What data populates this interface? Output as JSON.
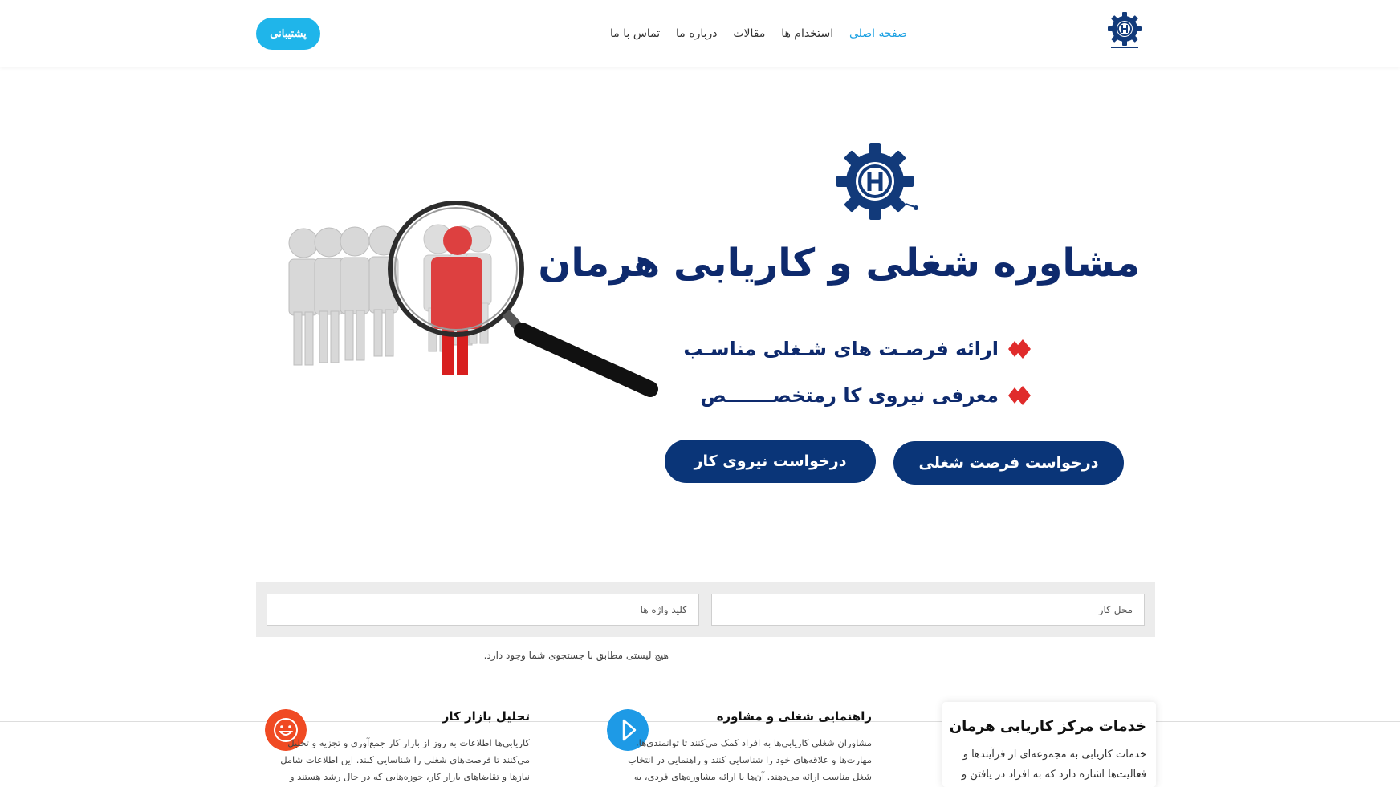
{
  "header": {
    "logo_icon": "hermanc-gear-logo-icon",
    "nav": [
      {
        "label": "صفحه اصلی",
        "active": true
      },
      {
        "label": "استخدام ها",
        "active": false
      },
      {
        "label": "مقالات",
        "active": false
      },
      {
        "label": "درباره ما",
        "active": false
      },
      {
        "label": "تماس با ما",
        "active": false
      }
    ],
    "support_label": "پشتیبانی"
  },
  "hero": {
    "title": "مشاوره شغلی و کاریابی هرمان",
    "bullets": [
      "ارائه فرصـت های شـغلی مناسـب",
      "معرفی نیروی کا رمتخصـــــــص"
    ],
    "cta_job": "درخواست فرصت شغلی",
    "cta_labor": "درخواست نیروی کار",
    "illustration": "magnifier-over-people-illustration"
  },
  "search": {
    "location_placeholder": "محل کار",
    "keywords_placeholder": "کلید واژه ها",
    "no_results": "هیچ لیستی مطابق با جستجوی شما وجود دارد."
  },
  "services": {
    "title": "خدمات مرکز کاریابی هرمان",
    "text": "خدمات کاریابی به مجموعه‌ای از فرآیندها و فعالیت‌ها اشاره دارد که به افراد در یافتن و"
  },
  "features": [
    {
      "icon": "play-icon",
      "title": "راهنمایی شغلی و مشاوره",
      "text": "مشاوران شغلی کاریابی‌ها به افراد کمک می‌کنند تا توانمندی‌ها، مهارت‌ها و علاقه‌های خود را شناسایی کنند و راهنمایی در انتخاب شغل مناسب ارائه می‌دهند. آن‌ها با ارائه مشاوره‌های فردی، به"
    },
    {
      "icon": "smiley-icon",
      "title": "تحلیل بازار کار",
      "text": "کاریابی‌ها اطلاعات به روز از بازار کار جمع‌آوری و تجزیه و تحلیل می‌کنند تا فرصت‌های شغلی را شناسایی کنند. این اطلاعات شامل نیازها و تقاضاهای بازار کار، حوزه‌هایی که در حال رشد هستند و"
    }
  ],
  "colors": {
    "accent": "#1ba0e2",
    "navy": "#0a3578",
    "title_navy": "#0e2a6d",
    "diamond_red": "#e02b2b",
    "support_blue": "#1fb5ea",
    "play_blue": "#1e9ae6",
    "smiley_orange": "#f04a23"
  }
}
